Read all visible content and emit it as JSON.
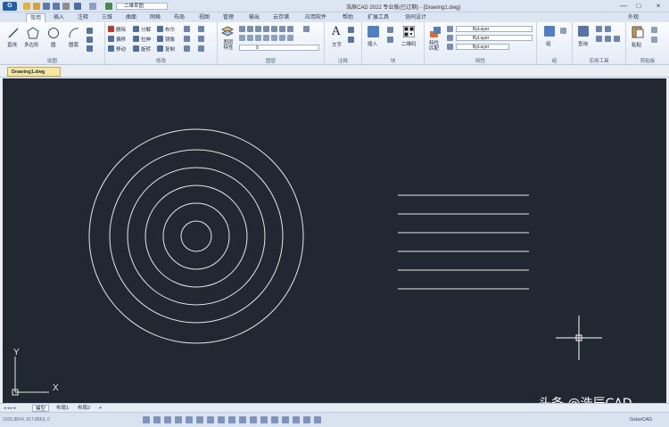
{
  "window": {
    "title": "浩辰CAD 2022 专业版(已过期) - [Drawing1.dwg]",
    "workspace": "二维草图",
    "min": "—",
    "max": "□",
    "close": "×"
  },
  "menu_tabs": [
    "常用",
    "插入",
    "注释",
    "三维",
    "曲面",
    "网格",
    "布局",
    "视图",
    "管理",
    "输出",
    "云存储",
    "应用软件",
    "帮助",
    "扩展工具",
    "协同设计"
  ],
  "menu_right": "外观",
  "ribbon": {
    "draw": {
      "label": "绘图",
      "line": "直线",
      "polygon": "多边形",
      "circle": "圆",
      "arc": "圆弧"
    },
    "modify": {
      "label": "修改",
      "items": [
        "删除",
        "分解",
        "布尔",
        "偏移",
        "拉伸",
        "镜像",
        "移动",
        "旋转",
        "复制"
      ]
    },
    "layer": {
      "label": "图层",
      "props": "图层特性",
      "current": "0"
    },
    "annotation": {
      "label": "注释",
      "text": "文字"
    },
    "block": {
      "label": "块",
      "insert": "插入",
      "qrcode": "二维码"
    },
    "properties": {
      "label": "特性",
      "match": "特性匹配",
      "color": "ByLayer",
      "linetype": "ByLayer",
      "lineweight": "ByLayer"
    },
    "group": {
      "label": "组",
      "group": "组"
    },
    "utilities": {
      "label": "实用工具",
      "measure": "查询"
    },
    "clipboard": {
      "label": "剪贴板",
      "paste": "粘贴"
    }
  },
  "document_tab": "Drawing1.dwg",
  "ucs": {
    "x": "X",
    "y": "Y"
  },
  "layout_tabs": [
    "模型",
    "布局1",
    "布局2"
  ],
  "status": {
    "coords": "1205.8814, 917.8963, 0",
    "brand": "GstarCAD"
  },
  "watermark": "头条 @浩辰CAD",
  "drawing": {
    "circle_radii": [
      17,
      37,
      57,
      77,
      97,
      120
    ],
    "line_count": 6
  },
  "colors": {
    "canvas": "#212832",
    "geometry": "#e6e6e6",
    "ribbon": "#e4ebf5"
  }
}
